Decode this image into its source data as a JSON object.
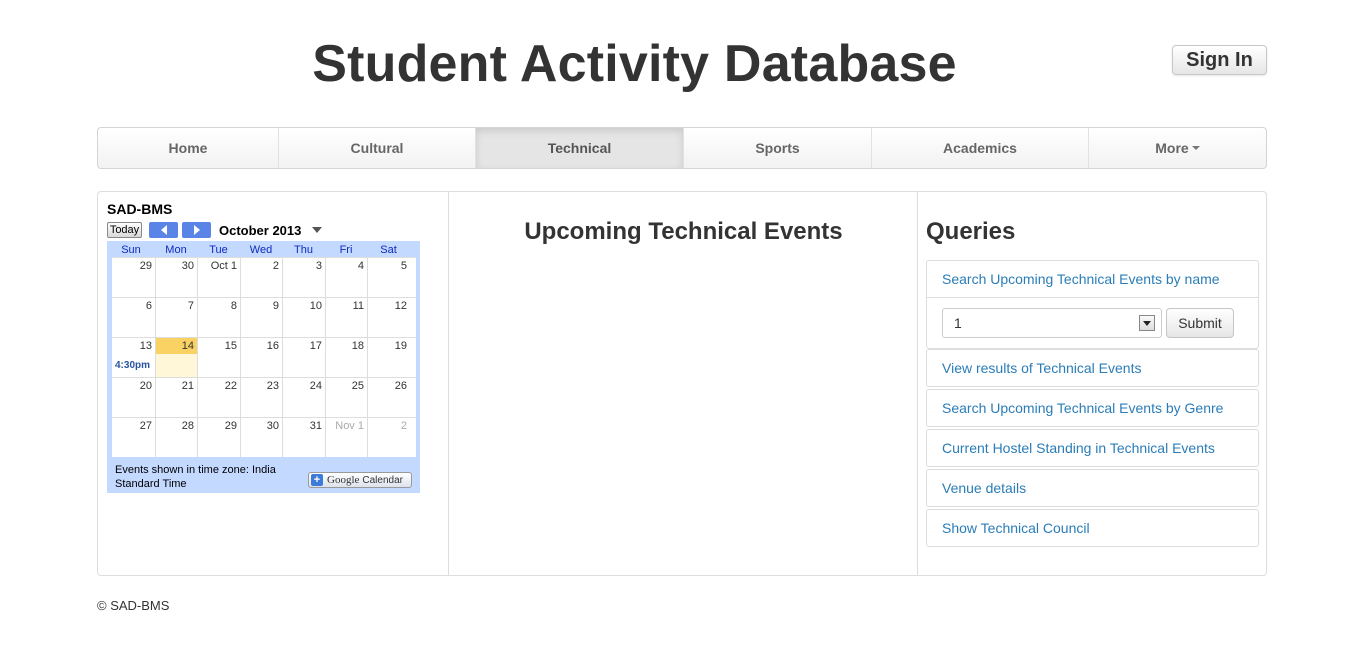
{
  "header": {
    "title": "Student Activity Database",
    "signin_label": "Sign In"
  },
  "nav": {
    "items": [
      {
        "label": "Home"
      },
      {
        "label": "Cultural"
      },
      {
        "label": "Technical"
      },
      {
        "label": "Sports"
      },
      {
        "label": "Academics"
      },
      {
        "label": "More"
      }
    ],
    "active": "Technical"
  },
  "calendar": {
    "title": "SAD-BMS",
    "today_label": "Today",
    "month_label": "October 2013",
    "weekdays": [
      "Sun",
      "Mon",
      "Tue",
      "Wed",
      "Thu",
      "Fri",
      "Sat"
    ],
    "weeks": [
      [
        "29",
        "30",
        "Oct 1",
        "2",
        "3",
        "4",
        "5"
      ],
      [
        "6",
        "7",
        "8",
        "9",
        "10",
        "11",
        "12"
      ],
      [
        "13",
        "14",
        "15",
        "16",
        "17",
        "18",
        "19"
      ],
      [
        "20",
        "21",
        "22",
        "23",
        "24",
        "25",
        "26"
      ],
      [
        "27",
        "28",
        "29",
        "30",
        "31",
        "Nov 1",
        "2"
      ]
    ],
    "today": "14",
    "event_time": "4:30pm",
    "timezone_note": "Events shown in time zone: India Standard Time",
    "gcal_google": "Google",
    "gcal_calendar": "Calendar",
    "today_color": "#fad163",
    "frame_color": "#c3d9ff"
  },
  "main": {
    "heading": "Upcoming Technical Events"
  },
  "queries": {
    "heading": "Queries",
    "search_by_name": "Search Upcoming Technical Events by name",
    "select_value": "1",
    "submit_label": "Submit",
    "links": [
      "View results of Technical Events",
      "Search Upcoming Technical Events by Genre",
      "Current Hostel Standing in Technical Events",
      "Venue details",
      "Show Technical Council"
    ],
    "link_color": "#2a7db8"
  },
  "footer": {
    "text": "© SAD-BMS"
  }
}
